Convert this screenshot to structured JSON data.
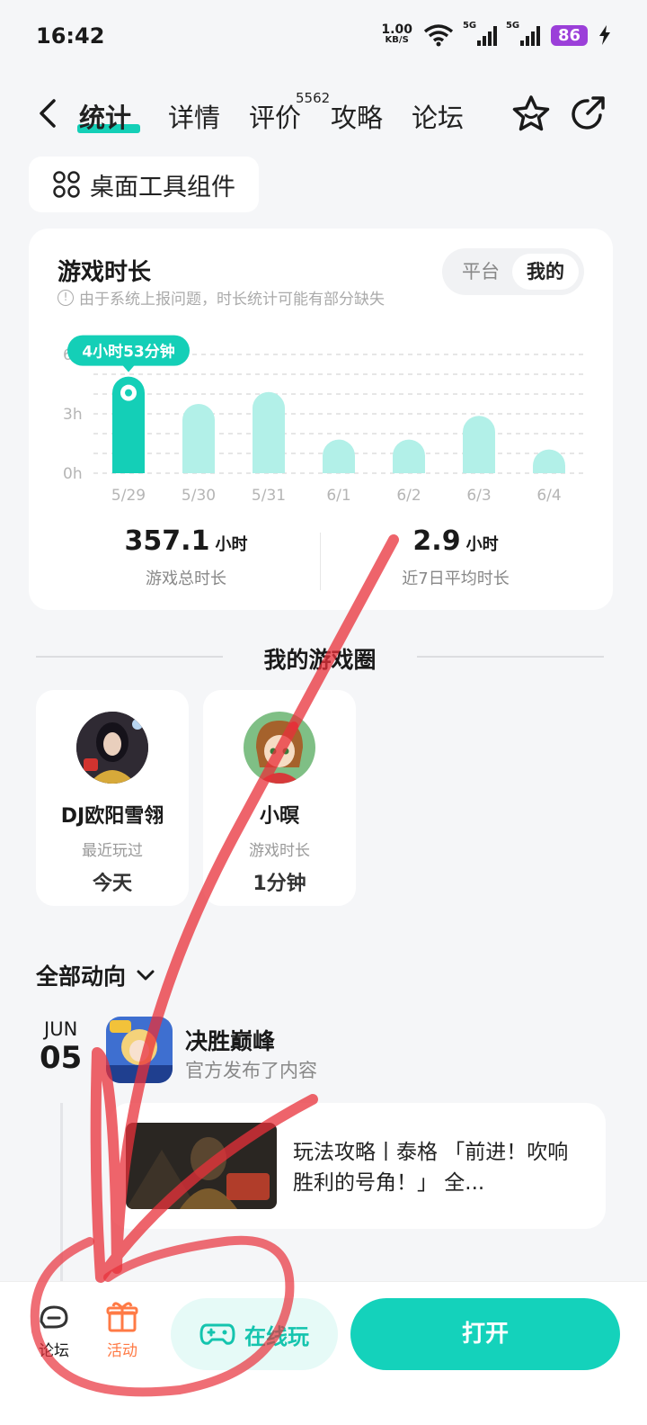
{
  "status_bar": {
    "time": "16:42",
    "speed_value": "1.00",
    "speed_unit": "KB/S",
    "network1": "5G",
    "network2": "5G",
    "battery": "86"
  },
  "nav": {
    "tabs": [
      {
        "label": "统计",
        "active": true
      },
      {
        "label": "详情",
        "active": false
      },
      {
        "label": "评价",
        "active": false
      },
      {
        "label": "攻略",
        "active": false
      },
      {
        "label": "论坛",
        "active": false
      }
    ],
    "review_count": "5562"
  },
  "widget_button": "桌面工具组件",
  "playtime_card": {
    "title": "游戏时长",
    "note": "由于系统上报问题，时长统计可能有部分缺失",
    "toggle": {
      "options": [
        "平台",
        "我的"
      ],
      "selected": "我的"
    },
    "tooltip": "4小时53分钟",
    "stats": [
      {
        "value": "357.1",
        "unit": "小时",
        "label": "游戏总时长"
      },
      {
        "value": "2.9",
        "unit": "小时",
        "label": "近7日平均时长"
      }
    ]
  },
  "chart_data": {
    "type": "bar",
    "categories": [
      "5/29",
      "5/30",
      "5/31",
      "6/1",
      "6/2",
      "6/3",
      "6/4"
    ],
    "values": [
      4.88,
      3.5,
      4.1,
      1.7,
      1.7,
      2.9,
      1.2
    ],
    "selected_index": 0,
    "ylim": [
      0,
      6
    ],
    "yticks": [
      {
        "v": 6,
        "label": "6"
      },
      {
        "v": 3,
        "label": "3h"
      },
      {
        "v": 0,
        "label": "0h"
      }
    ],
    "ylabel": "",
    "xlabel": "",
    "grid": true,
    "colors": {
      "selected": "#14cfb7",
      "normal": "#b2f0e8"
    }
  },
  "game_circle": {
    "title": "我的游戏圈",
    "friends": [
      {
        "name": "DJ欧阳雪翎",
        "meta": "最近玩过",
        "value": "今天"
      },
      {
        "name": "小暝",
        "meta": "游戏时长",
        "value": "1分钟"
      }
    ]
  },
  "feed": {
    "filter": "全部动向",
    "date_month": "JUN",
    "date_day": "05",
    "game_name": "决胜巅峰",
    "action": "官方发布了内容",
    "post_title": "玩法攻略丨泰格 「前进！吹响胜利的号角！」 全..."
  },
  "bottom_bar": {
    "forum": "论坛",
    "activity": "活动",
    "online_play": "在线玩",
    "open": "打开"
  },
  "colors": {
    "accent": "#14d2bb",
    "activity": "#ff7a45",
    "annotation": "#e8303a"
  }
}
